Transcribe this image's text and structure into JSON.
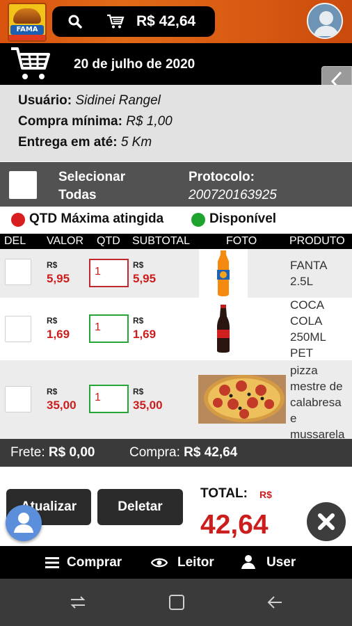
{
  "header": {
    "logo_text": "FAMA",
    "cart_total": "R$ 42,64"
  },
  "order": {
    "date": "20 de julho de 2020",
    "user_label": "Usuário:",
    "user_value": "Sidinei Rangel",
    "min_label": "Compra mínima:",
    "min_value": "R$ 1,00",
    "delivery_label": "Entrega em até:",
    "delivery_value": "5 Km"
  },
  "selection": {
    "select_all_line1": "Selecionar",
    "select_all_line2": "Todas",
    "protocol_label": "Protocolo:",
    "protocol_value": "200720163925"
  },
  "legend": {
    "max_label": "QTD Máxima atingida",
    "available_label": "Disponível",
    "max_color": "#d81e1e",
    "available_color": "#1fa32e"
  },
  "table": {
    "headers": [
      "DEL",
      "VALOR",
      "QTD",
      "SUBTOTAL",
      "FOTO",
      "PRODUTO"
    ],
    "rows": [
      {
        "currency": "R$",
        "price": "5,95",
        "qty": "1",
        "subtotal_currency": "R$",
        "subtotal": "5,95",
        "product": [
          "FANTA",
          "2.5L"
        ],
        "status": "max"
      },
      {
        "currency": "R$",
        "price": "1,69",
        "qty": "1",
        "subtotal_currency": "R$",
        "subtotal": "1,69",
        "product": [
          "COCA",
          "COLA",
          "250ML",
          "PET"
        ],
        "status": "available"
      },
      {
        "currency": "R$",
        "price": "35,00",
        "qty": "1",
        "subtotal_currency": "R$",
        "subtotal": "35,00",
        "product": [
          "pizza",
          "mestre de",
          "calabresa",
          "e",
          "mussarela"
        ],
        "status": "available"
      }
    ]
  },
  "summary": {
    "freight_label": "Frete:",
    "freight_value": "R$ 0,00",
    "purchase_label": "Compra:",
    "purchase_value": "R$ 42,64"
  },
  "actions": {
    "update_label": "Atualizar",
    "delete_label": "Deletar",
    "total_label": "TOTAL:",
    "total_currency": "R$",
    "total_value": "42,64"
  },
  "bottom_nav": {
    "buy_label": "Comprar",
    "reader_label": "Leitor",
    "user_label": "User"
  }
}
